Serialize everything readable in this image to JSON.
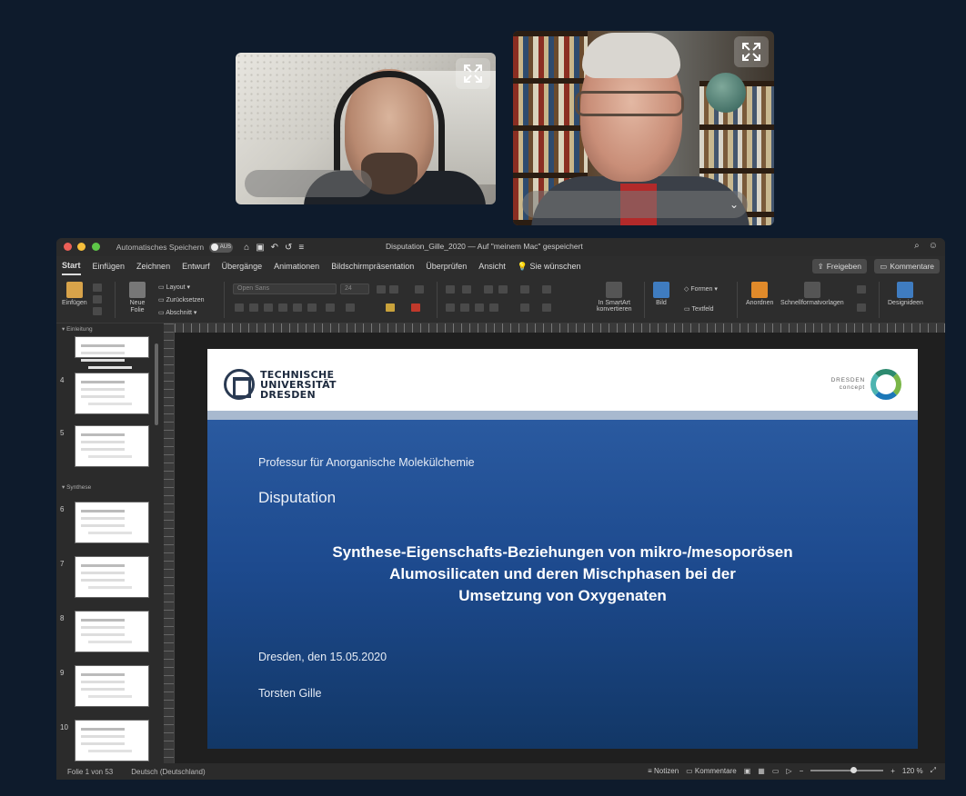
{
  "video_call": {
    "tiles": [
      {
        "name": "",
        "expand_icon": "expand-icon"
      },
      {
        "name": "",
        "expand_icon": "expand-icon"
      }
    ]
  },
  "window": {
    "autosave_label": "Automatisches Speichern",
    "autosave_state": "AUS",
    "doc_title": "Disputation_Gille_2020 — Auf \"meinem Mac\" gespeichert",
    "search_icon": "search-icon",
    "account_icon": "smiley-icon"
  },
  "ribbon_tabs": [
    "Start",
    "Einfügen",
    "Zeichnen",
    "Entwurf",
    "Übergänge",
    "Animationen",
    "Bildschirmpräsentation",
    "Überprüfen",
    "Ansicht"
  ],
  "tell_me": "Sie wünschen",
  "share_button": "Freigeben",
  "comments_button": "Kommentare",
  "ribbon": {
    "paste": "Einfügen",
    "new_slide": "Neue\nFolie",
    "layout": "Layout",
    "reset": "Zurücksetzen",
    "section": "Abschnitt",
    "font_name": "Open Sans",
    "font_size": "24",
    "smartart": "In SmartArt\nkonvertieren",
    "picture": "Bild",
    "shapes": "Formen",
    "textbox": "Textfeld",
    "arrange": "Anordnen",
    "quick_styles": "Schnellformatvorlagen",
    "designer": "Designideen"
  },
  "sidebar": {
    "sections": [
      "Einleitung",
      "Synthese"
    ],
    "thumb_numbers": [
      "4",
      "5",
      "6",
      "7",
      "8",
      "9",
      "10"
    ]
  },
  "slide": {
    "tud_logo_lines": [
      "TECHNISCHE",
      "UNIVERSITÄT",
      "DRESDEN"
    ],
    "dc_logo_lines": [
      "DRESDEN",
      "concept"
    ],
    "professorship": "Professur für Anorganische Molekülchemie",
    "heading": "Disputation",
    "title_lines": [
      "Synthese-Eigenschafts-Beziehungen von mikro-/mesoporösen",
      "Alumosilicaten und deren Mischphasen bei der",
      "Umsetzung von Oxygenaten"
    ],
    "date": "Dresden, den 15.05.2020",
    "author": "Torsten Gille"
  },
  "statusbar": {
    "slide_counter": "Folie 1 von 53",
    "language": "Deutsch (Deutschland)",
    "notes": "Notizen",
    "comments": "Kommentare",
    "zoom": "120 %"
  }
}
